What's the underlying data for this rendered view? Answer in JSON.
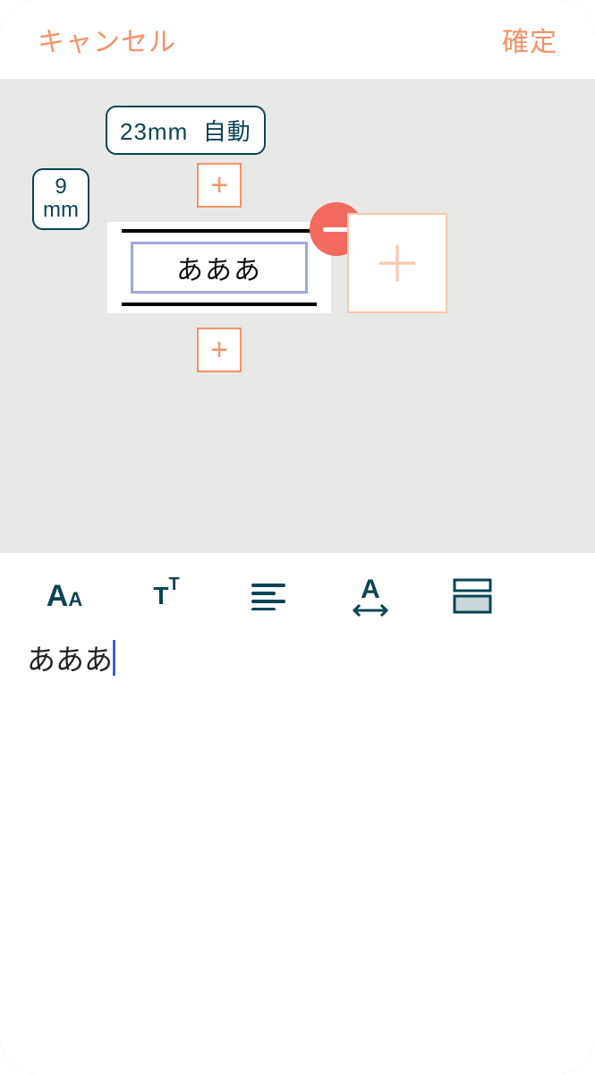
{
  "header": {
    "cancel": "キャンセル",
    "confirm": "確定"
  },
  "label": {
    "width_value": "23mm",
    "width_mode": "自動",
    "height_value": "9",
    "height_unit": "mm",
    "text": "あああ"
  },
  "editor": {
    "input_text": "あああ"
  },
  "icons": {
    "plus": "+",
    "minus": "−"
  },
  "toolbar": {
    "font": "font-icon",
    "size": "text-size-icon",
    "align": "align-left-icon",
    "spacing": "letter-spacing-icon",
    "layout": "layout-icon"
  }
}
